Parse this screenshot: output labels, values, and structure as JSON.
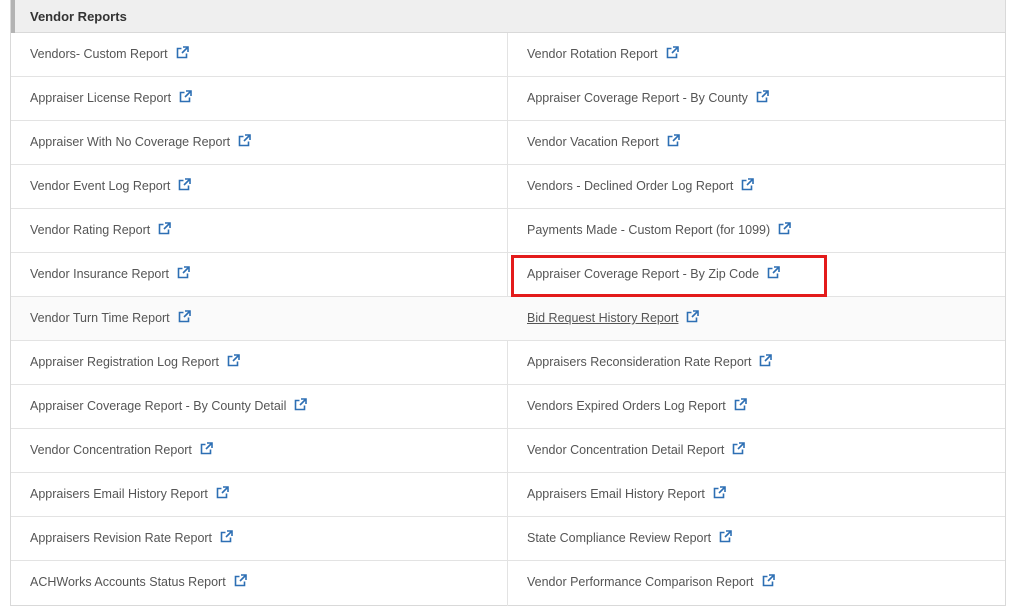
{
  "section": {
    "title": "Vendor Reports"
  },
  "reports": [
    {
      "left": "Vendors- Custom Report",
      "right": "Vendor Rotation Report"
    },
    {
      "left": "Appraiser License Report",
      "right": "Appraiser Coverage Report - By County"
    },
    {
      "left": "Appraiser With No Coverage Report",
      "right": "Vendor Vacation Report"
    },
    {
      "left": "Vendor Event Log Report",
      "right": "Vendors - Declined Order Log Report"
    },
    {
      "left": "Vendor Rating Report",
      "right": "Payments Made - Custom Report (for 1099)"
    },
    {
      "left": "Vendor Insurance Report",
      "right": "Appraiser Coverage Report - By Zip Code"
    },
    {
      "left": "Vendor Turn Time Report",
      "right": "Bid Request History Report"
    },
    {
      "left": "Appraiser Registration Log Report",
      "right": "Appraisers Reconsideration Rate Report"
    },
    {
      "left": "Appraiser Coverage Report - By County Detail",
      "right": "Vendors Expired Orders Log Report"
    },
    {
      "left": "Vendor Concentration Report",
      "right": "Vendor Concentration Detail Report"
    },
    {
      "left": "Appraisers Email History Report",
      "right": "Appraisers Email History Report"
    },
    {
      "left": "Appraisers Revision Rate Report",
      "right": "State Compliance Review Report"
    },
    {
      "left": "ACHWorks Accounts Status Report",
      "right": "Vendor Performance Comparison Report"
    }
  ],
  "icons": {
    "link": "external-link-icon"
  },
  "colors": {
    "highlight": "#e31b1b",
    "icon": "#2d6fb4",
    "text": "#555555"
  }
}
